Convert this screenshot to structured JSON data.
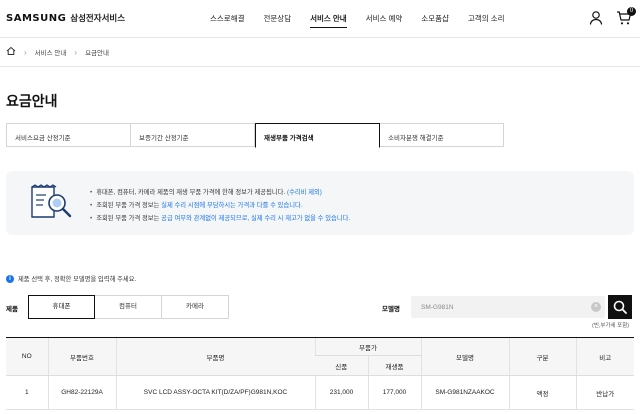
{
  "header": {
    "brand": "SAMSUNG",
    "service_name": "삼성전자서비스",
    "menu": [
      {
        "label": "스스로해결",
        "active": false
      },
      {
        "label": "전문상담",
        "active": false
      },
      {
        "label": "서비스 안내",
        "active": true
      },
      {
        "label": "서비스 예약",
        "active": false
      },
      {
        "label": "소모품샵",
        "active": false
      },
      {
        "label": "고객의 소리",
        "active": false
      }
    ],
    "cart_count": "0"
  },
  "breadcrumb": [
    "서비스 안내",
    "요금안내"
  ],
  "page_title": "요금안내",
  "tabs": [
    {
      "label": "서비스요금 산정기준",
      "active": false
    },
    {
      "label": "보증기간 산정기준",
      "active": false
    },
    {
      "label": "재생부품 가격검색",
      "active": true
    },
    {
      "label": "소비자분쟁 해결기준",
      "active": false
    }
  ],
  "info": {
    "line1": "휴대폰, 컴퓨터, 카메라 제품의 재생 부품 가격에 한해 정보가 제공됩니다.",
    "line1_link": "(수리비 제외)",
    "line2_a": "조회된 부품 가격 정보는 ",
    "line2_hl": "실제 수리 시점에 부담하시는 가격과 다를 수 있습니다.",
    "line3_a": "조회된 부품 가격 정보는 ",
    "line3_hl": "공급 여부와 관계없이 제공되므로, 실제 수리 시 재고가 없을 수 있습니다."
  },
  "notice": "제품 선택 후, 정확한 모델명을 입력해 주세요.",
  "filter": {
    "product_label": "제품",
    "products": [
      {
        "label": "휴대폰",
        "active": true
      },
      {
        "label": "컴퓨터",
        "active": false
      },
      {
        "label": "카메라",
        "active": false
      }
    ],
    "model_label": "모델명",
    "model_value": "SM-G981N",
    "hint": "(빈,부가세 포함)"
  },
  "table": {
    "headers": {
      "no": "NO",
      "part_no": "부품번호",
      "part_name": "부품명",
      "price": "부품가",
      "new": "신품",
      "refurb": "재생품",
      "model": "모델명",
      "type": "구분",
      "note": "비고"
    },
    "rows": [
      {
        "no": "1",
        "part_no": "GH82-22129A",
        "part_name": "SVC LCD ASSY-OCTA KIT(D/ZA/PF)G981N,KOC",
        "new_price": "231,000",
        "refurb_price": "177,000",
        "model": "SM-G981NZAAKOC",
        "type": "액정",
        "note": "반납가"
      }
    ]
  },
  "colors": {
    "accent": "#1a73e8",
    "dark": "#111111",
    "panel": "#f4f6f8"
  }
}
